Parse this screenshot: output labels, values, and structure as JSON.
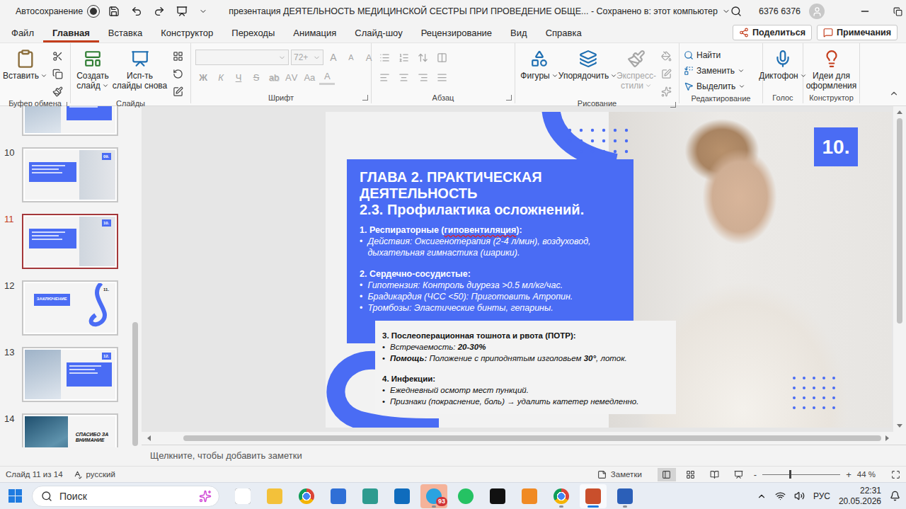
{
  "titlebar": {
    "autosave_label": "Автосохранение",
    "autosave_on": false,
    "title": "презентация ДЕЯТЕЛЬНОСТЬ МЕДИЦИНСКОЙ СЕСТРЫ ПРИ ПРОВЕДЕНИЕ ОБЩЕ... - Сохранено в: этот компьютер",
    "user": "6376 6376"
  },
  "tabs": [
    {
      "label": "Файл",
      "selected": false
    },
    {
      "label": "Главная",
      "selected": true
    },
    {
      "label": "Вставка",
      "selected": false
    },
    {
      "label": "Конструктор",
      "selected": false
    },
    {
      "label": "Переходы",
      "selected": false
    },
    {
      "label": "Анимация",
      "selected": false
    },
    {
      "label": "Слайд-шоу",
      "selected": false
    },
    {
      "label": "Рецензирование",
      "selected": false
    },
    {
      "label": "Вид",
      "selected": false
    },
    {
      "label": "Справка",
      "selected": false
    }
  ],
  "share": "Поделиться",
  "comments": "Примечания",
  "ribbon": {
    "clipboard": {
      "label": "Буфер обмена",
      "paste": [
        "Вставить"
      ]
    },
    "slides": {
      "label": "Слайды",
      "new_slide": [
        "Создать",
        "слайд"
      ],
      "reuse": [
        "Исп-ть",
        "слайды снова"
      ]
    },
    "font": {
      "label": "Шрифт",
      "disabled": true,
      "size": "72+",
      "row1": [
        {
          "text": "A",
          "kind": "grow"
        },
        {
          "text": "A",
          "kind": "shrink"
        },
        {
          "text": "A",
          "kind": "clear"
        }
      ],
      "row2": [
        {
          "text": "Ж",
          "kind": "bold"
        },
        {
          "text": "К",
          "kind": "italic"
        },
        {
          "text": "Ч",
          "kind": "underline"
        },
        {
          "text": "S",
          "kind": "strike"
        },
        {
          "text": "ab",
          "kind": "shadow"
        },
        {
          "text": "AV",
          "kind": "spacing"
        },
        {
          "text": "Aa",
          "kind": "case"
        },
        {
          "text": "A",
          "kind": "color"
        }
      ]
    },
    "paragraph": {
      "label": "Абзац",
      "disabled": true
    },
    "drawing": {
      "label": "Рисование",
      "buttons": [
        {
          "label": [
            "Фигуры"
          ],
          "kind": "shapes",
          "disabled": false
        },
        {
          "label": [
            "Упорядочить"
          ],
          "kind": "arrange",
          "disabled": false
        },
        {
          "label": [
            "Экспресс-",
            "стили"
          ],
          "kind": "styles",
          "disabled": true
        }
      ]
    },
    "editing": {
      "label": "Редактирование",
      "items": [
        {
          "label": "Найти",
          "kind": "find"
        },
        {
          "label": "Заменить",
          "kind": "replace"
        },
        {
          "label": "Выделить",
          "kind": "select"
        }
      ]
    },
    "voice": {
      "label": "Голос",
      "dictate": [
        "Диктофон"
      ]
    },
    "designer": {
      "label": "Конструктор",
      "ideas": [
        "Идеи для",
        "оформления"
      ]
    }
  },
  "thumbnails": [
    {
      "kind": "photo-left",
      "selected": false
    },
    {
      "number": "10",
      "kind": "photo-right",
      "selected": false,
      "badge": "09."
    },
    {
      "number": "11",
      "kind": "photo-right",
      "selected": true,
      "badge": "10."
    },
    {
      "number": "12",
      "kind": "conclusion",
      "selected": false,
      "badge": "11.",
      "title": "ЗАКЛЮЧЕНИЕ"
    },
    {
      "number": "13",
      "kind": "photo-left",
      "selected": false,
      "badge": "12."
    },
    {
      "number": "14",
      "kind": "thanks",
      "selected": false,
      "title": "СПАСИБО ЗА ВНИМАНИЕ"
    }
  ],
  "slide": {
    "badge": "10.",
    "bullet": "•",
    "heading": [
      "ГЛАВА 2. ПРАКТИЧЕСКАЯ",
      "ДЕЯТЕЛЬНОСТЬ",
      "2.3. Профилактика осложнений."
    ],
    "blue_sections": [
      {
        "title": [
          {
            "text": "1. Респираторные (",
            "spell_error": false
          },
          {
            "text": "гиповентиляция",
            "spell_error": true
          },
          {
            "text": "):",
            "spell_error": false
          }
        ],
        "items": [
          [
            {
              "text": "Действия: Оксигенотерапия (2-4 л/мин), воздуховод, дыхательная гимнастика (шарики).",
              "bold": false
            }
          ]
        ]
      },
      {
        "title": [
          {
            "text": "2. Сердечно-сосудистые:",
            "spell_error": false
          }
        ],
        "items": [
          [
            {
              "text": "Гипотензия: Контроль диуреза >0.5 мл/кг/час.",
              "bold": false
            }
          ],
          [
            {
              "text": "Брадикардия (ЧСС <50): Приготовить Атропин.",
              "bold": false
            }
          ],
          [
            {
              "text": "Тромбозы: Эластические бинты, гепарины.",
              "bold": false
            }
          ]
        ]
      }
    ],
    "grey_sections": [
      {
        "title": [
          {
            "text": "3. Послеоперационная тошнота и рвота (ПОТР):",
            "spell_error": false
          }
        ],
        "items": [
          [
            {
              "text": "Встречаемость: ",
              "bold": false
            },
            {
              "text": "20-30%",
              "bold": true
            }
          ],
          [
            {
              "text": "Помощь:",
              "bold": true
            },
            {
              "text": " Положение с приподнятым изголовьем ",
              "bold": false
            },
            {
              "text": "30°",
              "bold": true
            },
            {
              "text": ", лоток.",
              "bold": false
            }
          ]
        ]
      },
      {
        "title": [
          {
            "text": "4. Инфекции:",
            "spell_error": false
          }
        ],
        "items": [
          [
            {
              "text": "Ежедневный осмотр мест пункций.",
              "bold": false
            }
          ],
          [
            {
              "text": "Признаки (покраснение, боль) → удалить катетер немедленно.",
              "bold": false
            }
          ]
        ]
      }
    ]
  },
  "notes_placeholder": "Щелкните, чтобы добавить заметки",
  "status_bar": {
    "slide": "Слайд 11 из 14",
    "language": "русский",
    "notes": "Заметки",
    "views": [
      {
        "kind": "normal",
        "selected": true
      },
      {
        "kind": "sorter",
        "selected": false
      },
      {
        "kind": "reading",
        "selected": false
      },
      {
        "kind": "show",
        "selected": false
      }
    ],
    "zoom_minus": "-",
    "zoom_plus": "+",
    "zoom_level": 0.35,
    "zoom": "44 %"
  },
  "taskbar": {
    "search": "Поиск",
    "apps": [
      {
        "kind": "taskview",
        "color": "#3a3a3a",
        "open": false,
        "selected": false,
        "attention": false
      },
      {
        "kind": "explorer",
        "color": "#f3c13a",
        "open": false,
        "selected": false,
        "attention": false
      },
      {
        "kind": "chrome",
        "color": "#4285f4",
        "open": false,
        "selected": false,
        "attention": false
      },
      {
        "kind": "store",
        "color": "#2f6fd6",
        "open": false,
        "selected": false,
        "attention": false
      },
      {
        "kind": "app",
        "color": "#2e9b8f",
        "open": false,
        "selected": false,
        "attention": false
      },
      {
        "kind": "outlook",
        "color": "#0f6cbd",
        "open": false,
        "selected": false,
        "attention": false
      },
      {
        "kind": "telegram",
        "color": "#2aa3e0",
        "open": true,
        "selected": false,
        "attention": true,
        "badge": "93"
      },
      {
        "kind": "whatsapp",
        "color": "#25c263",
        "open": false,
        "selected": false,
        "attention": false
      },
      {
        "kind": "notes",
        "color": "#111111",
        "open": false,
        "selected": false,
        "attention": false
      },
      {
        "kind": "sublime",
        "color": "#f08a24",
        "open": false,
        "selected": false,
        "attention": false
      },
      {
        "kind": "chrome",
        "color": "#4285f4",
        "open": true,
        "selected": false,
        "attention": false
      },
      {
        "kind": "powerpoint",
        "color": "#c94f2c",
        "open": true,
        "selected": true,
        "attention": false
      },
      {
        "kind": "word",
        "color": "#2b5fb8",
        "open": true,
        "selected": false,
        "attention": false
      }
    ],
    "lang": "РУС",
    "time": "22:31",
    "date": "20.05.2026"
  }
}
